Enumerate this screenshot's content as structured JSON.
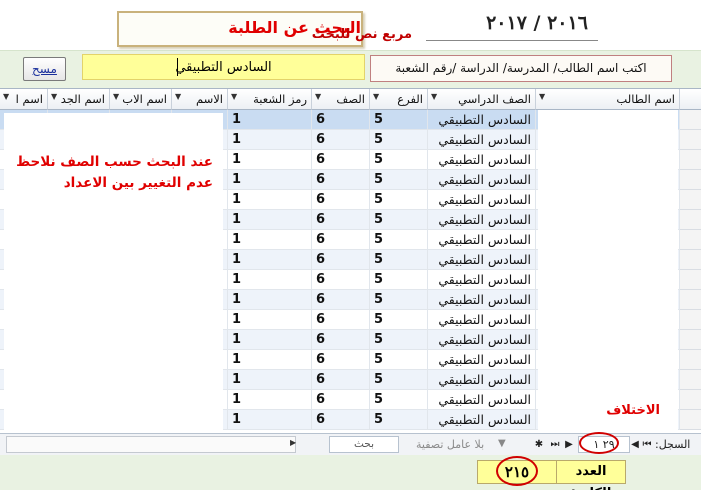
{
  "header": {
    "title": "البحث عن الطلبة",
    "search_box_label": "مربع نص للبحث",
    "academic_year": "٢٠١٦ / ٢٠١٧"
  },
  "toolbar": {
    "clear_button_label": "مسح",
    "search_value": "السادس التطبيقي",
    "hint": "اكتب اسم الطالب/ المدرسة/ الدراسة /رقم الشعبة"
  },
  "columns": [
    "اسم الطالب",
    "الصف الدراسي",
    "الفرع",
    "الصف",
    "رمز الشعبة",
    "الاسم",
    "اسم الاب",
    "اسم الجد",
    "اسم ا"
  ],
  "rows": [
    {
      "grade": "السادس التطبيقي",
      "branch": "5",
      "class": "6",
      "section": "1"
    },
    {
      "grade": "السادس التطبيقي",
      "branch": "5",
      "class": "6",
      "section": "1"
    },
    {
      "grade": "السادس التطبيقي",
      "branch": "5",
      "class": "6",
      "section": "1"
    },
    {
      "grade": "السادس التطبيقي",
      "branch": "5",
      "class": "6",
      "section": "1"
    },
    {
      "grade": "السادس التطبيقي",
      "branch": "5",
      "class": "6",
      "section": "1"
    },
    {
      "grade": "السادس التطبيقي",
      "branch": "5",
      "class": "6",
      "section": "1"
    },
    {
      "grade": "السادس التطبيقي",
      "branch": "5",
      "class": "6",
      "section": "1"
    },
    {
      "grade": "السادس التطبيقي",
      "branch": "5",
      "class": "6",
      "section": "1"
    },
    {
      "grade": "السادس التطبيقي",
      "branch": "5",
      "class": "6",
      "section": "1"
    },
    {
      "grade": "السادس التطبيقي",
      "branch": "5",
      "class": "6",
      "section": "1"
    },
    {
      "grade": "السادس التطبيقي",
      "branch": "5",
      "class": "6",
      "section": "1"
    },
    {
      "grade": "السادس التطبيقي",
      "branch": "5",
      "class": "6",
      "section": "1"
    },
    {
      "grade": "السادس التطبيقي",
      "branch": "5",
      "class": "6",
      "section": "1"
    },
    {
      "grade": "السادس التطبيقي",
      "branch": "5",
      "class": "6",
      "section": "1"
    },
    {
      "grade": "السادس التطبيقي",
      "branch": "5",
      "class": "6",
      "section": "1"
    },
    {
      "grade": "السادس التطبيقي",
      "branch": "5",
      "class": "6",
      "section": "1"
    }
  ],
  "annotations": {
    "note_line1": "عند البحث حسب الصف نلاحظ",
    "note_line2": "عدم التغيير بين الاعداد",
    "difference_label": "الاختلاف"
  },
  "navigation": {
    "record_label": "السجل:",
    "record_position": "٢٩ ١",
    "filter_label": "بلا عامل تصفية",
    "search_label": "بحث"
  },
  "summary": {
    "total_label": "العدد الكلي:",
    "total_value": "٢١٥"
  },
  "colors": {
    "band_green": "#e9f2e2",
    "input_yellow": "#ffff99",
    "annotation_red": "#e00000",
    "selected_row": "#c9dcf2"
  }
}
